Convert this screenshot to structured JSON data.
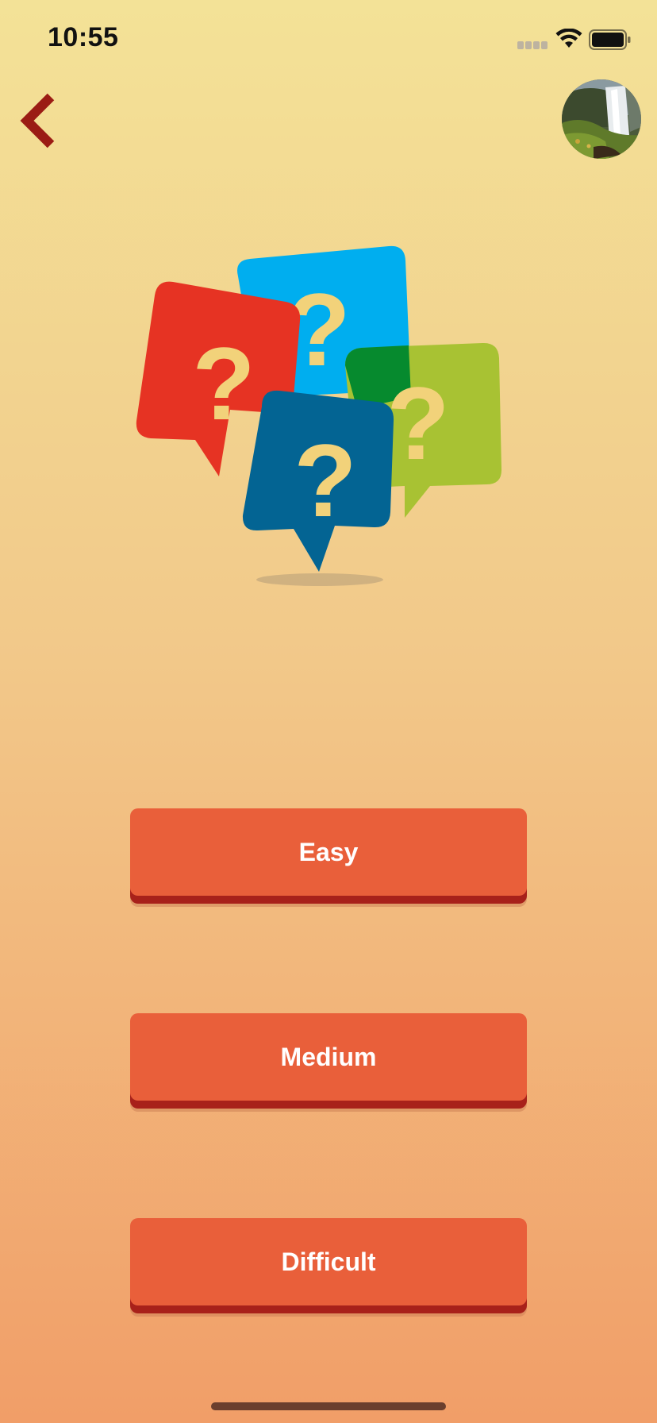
{
  "status_bar": {
    "time": "10:55",
    "icons": [
      "cellular-signal-icon",
      "wifi-icon",
      "battery-icon"
    ]
  },
  "nav": {
    "back_icon": "chevron-left-icon",
    "avatar_image": "waterfall-landscape-avatar"
  },
  "hero": {
    "illustration": "question-mark-speech-bubbles"
  },
  "levels": {
    "easy_label": "Easy",
    "medium_label": "Medium",
    "difficult_label": "Difficult"
  },
  "colors": {
    "background_top": "#f3e297",
    "background_bottom": "#f19e68",
    "button": "#e95f3a",
    "button_shadow": "#a8211a",
    "back_chevron": "#9b1c14",
    "bubble_red": "#e63323",
    "bubble_light_blue": "#00aeef",
    "bubble_green": "#a8c233",
    "bubble_dark_blue": "#036493"
  }
}
